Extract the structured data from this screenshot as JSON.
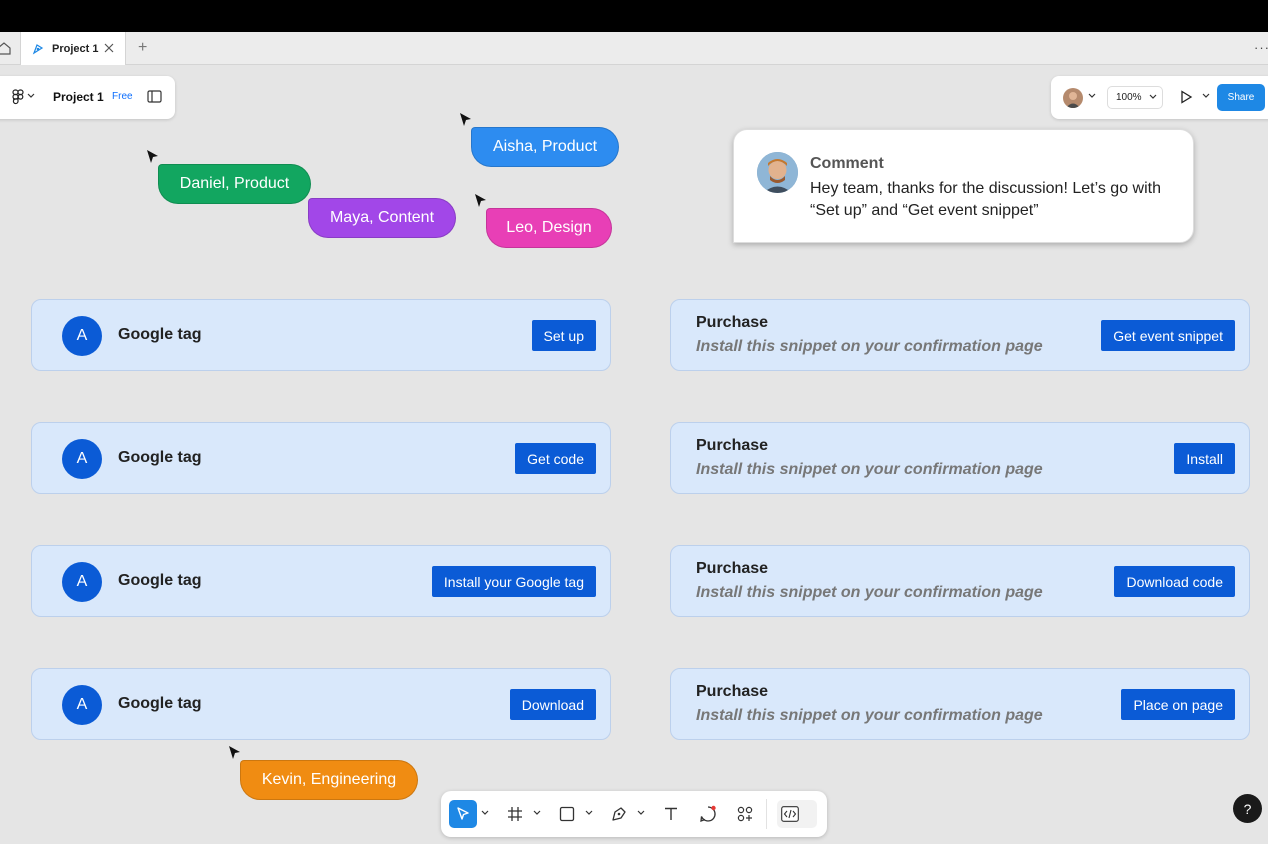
{
  "tabbar": {
    "tab_title": "Project 1",
    "add_label": "+",
    "more_label": "···"
  },
  "file_panel": {
    "project_name": "Project 1",
    "plan_badge": "Free"
  },
  "right_panel": {
    "zoom_value": "100%",
    "share_label": "Share"
  },
  "collaborators": [
    {
      "name": "Aisha, Product",
      "color": "#2d8cf0"
    },
    {
      "name": "Daniel, Product",
      "color": "#12a660"
    },
    {
      "name": "Maya, Content",
      "color": "#a247e8"
    },
    {
      "name": "Leo, Design",
      "color": "#e83fb6"
    },
    {
      "name": "Kevin, Engineering",
      "color": "#f08c12"
    }
  ],
  "comment": {
    "title": "Comment",
    "text": "Hey team, thanks for the discussion! Let’s go with “Set up” and “Get event snippet”"
  },
  "left_cards": [
    {
      "letter": "A",
      "title": "Google tag",
      "button": "Set up"
    },
    {
      "letter": "A",
      "title": "Google tag",
      "button": "Get code"
    },
    {
      "letter": "A",
      "title": "Google tag",
      "button": "Install your Google tag"
    },
    {
      "letter": "A",
      "title": "Google tag",
      "button": "Download"
    }
  ],
  "right_cards": [
    {
      "title": "Purchase",
      "subtitle": "Install this snippet on your confirmation page",
      "button": "Get event snippet"
    },
    {
      "title": "Purchase",
      "subtitle": "Install this snippet on your confirmation page",
      "button": "Install"
    },
    {
      "title": "Purchase",
      "subtitle": "Install this snippet on your confirmation page",
      "button": "Download code"
    },
    {
      "title": "Purchase",
      "subtitle": "Install this snippet on your confirmation page",
      "button": "Place on page"
    }
  ],
  "help_label": "?",
  "colors": {
    "accent": "#0b5bd6",
    "card_bg": "#d9e8fb",
    "canvas": "#e5e5e5"
  }
}
